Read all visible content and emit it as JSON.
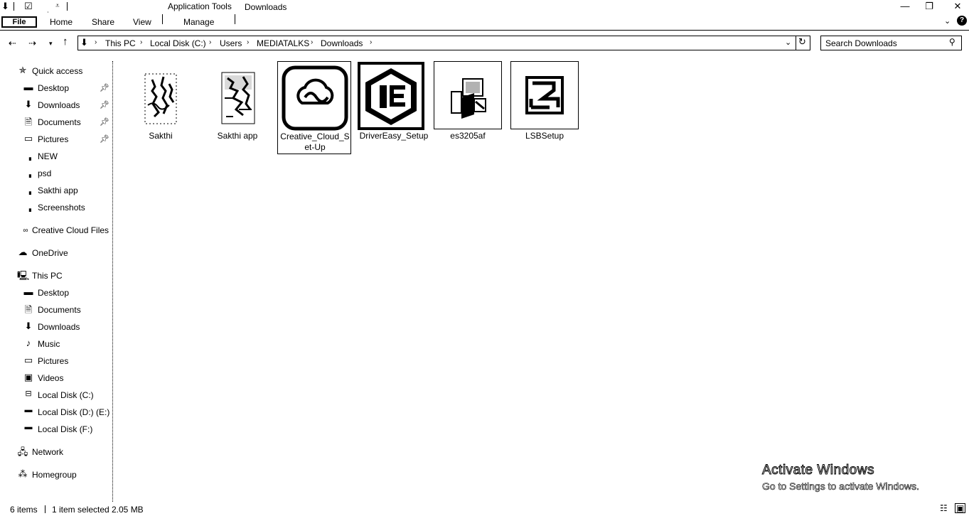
{
  "window": {
    "title": "Downloads",
    "context_tab_group": "Application Tools"
  },
  "ribbon": {
    "tabs": [
      "File",
      "Home",
      "Share",
      "View",
      "Manage"
    ]
  },
  "address": {
    "crumbs": [
      "This PC",
      "Local Disk (C:)",
      "Users",
      "MEDIATALKS",
      "Downloads"
    ]
  },
  "search": {
    "placeholder": "Search Downloads"
  },
  "sidebar": {
    "quick_access": "Quick access",
    "quick_items": [
      "Desktop",
      "Downloads",
      "Documents",
      "Pictures",
      "NEW",
      "psd",
      "Sakthi app",
      "Screenshots"
    ],
    "creative_cloud": "Creative Cloud Files",
    "onedrive": "OneDrive",
    "this_pc": "This PC",
    "pc_items": [
      "Desktop",
      "Documents",
      "Downloads",
      "Music",
      "Pictures",
      "Videos",
      "Local Disk (C:)",
      "Local Disk (D:) (E:)",
      "Local Disk (F:)"
    ],
    "network": "Network",
    "homegroup": "Homegroup"
  },
  "files": [
    {
      "name": "Sakthi",
      "icon": "folder-image-icon"
    },
    {
      "name": "Sakthi app",
      "icon": "folder-image-icon"
    },
    {
      "name": "Creative_Cloud_Set-Up",
      "icon": "creative-cloud-icon"
    },
    {
      "name": "DriverEasy_Setup",
      "icon": "drivereasy-icon"
    },
    {
      "name": "es3205af",
      "icon": "installer-icon"
    },
    {
      "name": "LSBSetup",
      "icon": "lsb-setup-icon"
    }
  ],
  "status": {
    "items": "6 items",
    "selected": "1 item selected",
    "size": "2.05 MB"
  },
  "watermark": {
    "line1": "Activate Windows",
    "line2": "Go to Settings to activate Windows."
  }
}
